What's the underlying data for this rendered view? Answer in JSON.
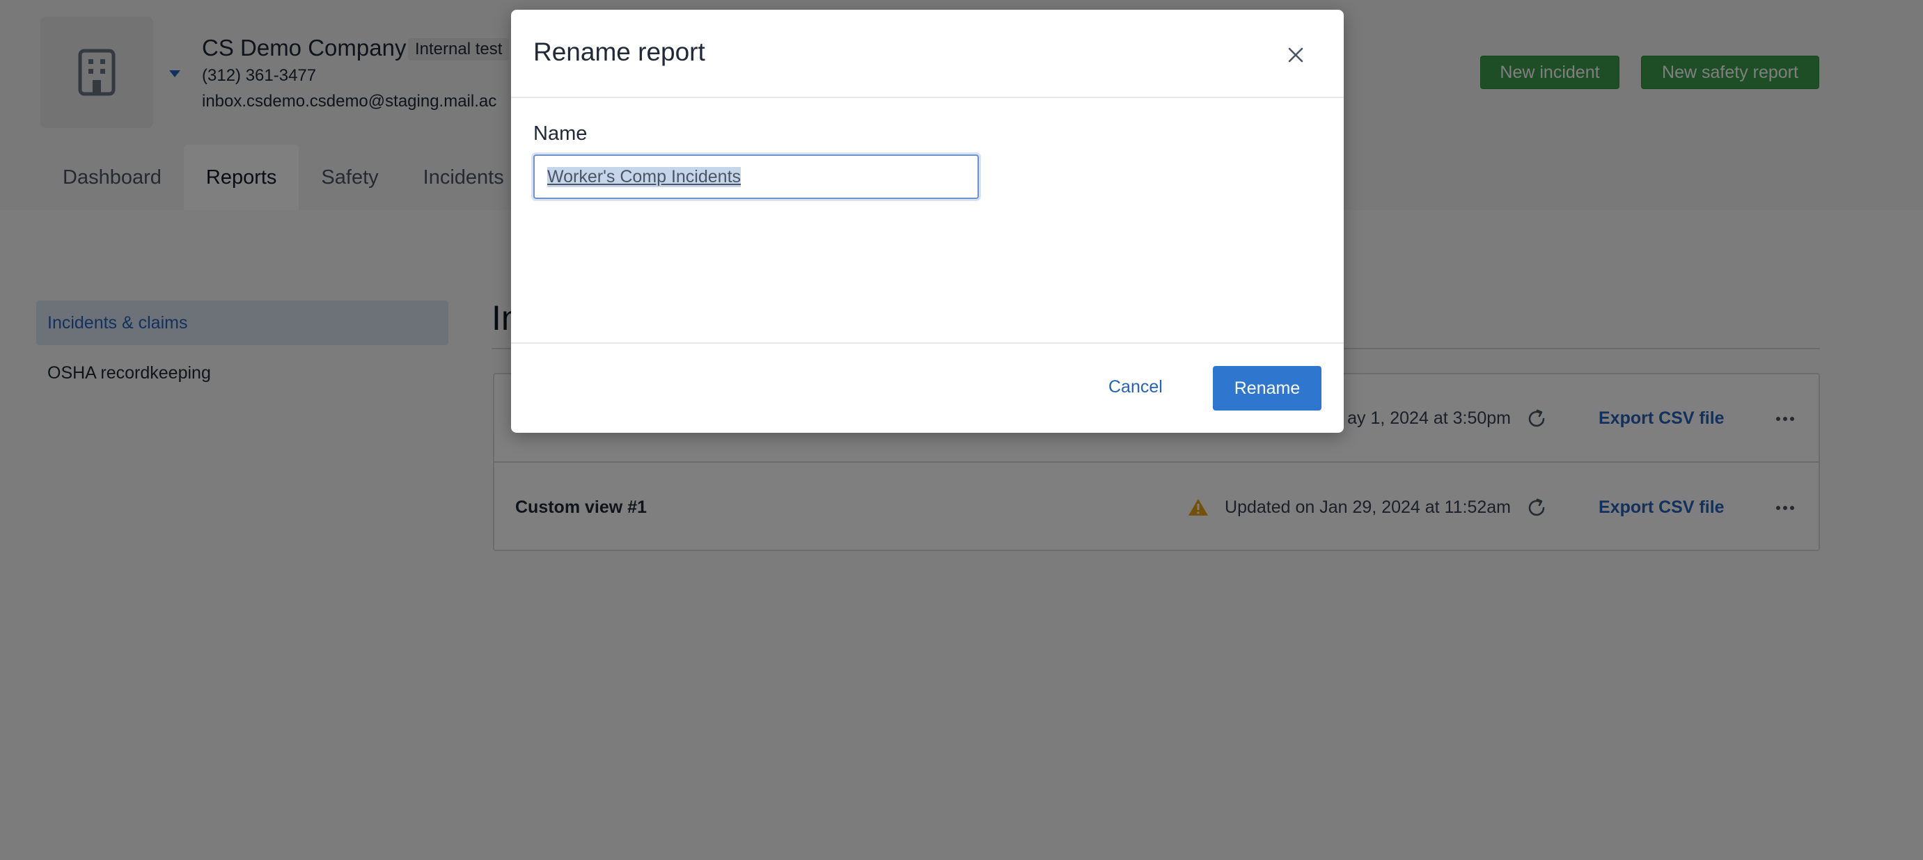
{
  "header": {
    "company_name": "CS Demo Company",
    "company_badge": "Internal test",
    "phone": "(312) 361-3477",
    "email": "inbox.csdemo.csdemo@staging.mail.ac",
    "new_incident_label": "New incident",
    "new_safety_report_label": "New safety report",
    "icons": {
      "logo": "building-icon",
      "dropdown": "caret-down-icon"
    }
  },
  "tabs": [
    {
      "label": "Dashboard",
      "active": false
    },
    {
      "label": "Reports",
      "active": true
    },
    {
      "label": "Safety",
      "active": false
    },
    {
      "label": "Incidents",
      "active": false
    }
  ],
  "sidebar": {
    "items": [
      {
        "label": "Incidents & claims",
        "active": true
      },
      {
        "label": "OSHA recordkeeping",
        "active": false
      }
    ]
  },
  "main": {
    "heading": "In",
    "reports": [
      {
        "name": "",
        "updated": "ay 1, 2024 at 3:50pm",
        "warning": false,
        "export_label": "Export CSV file"
      },
      {
        "name": "Custom view #1",
        "updated": "Updated on Jan 29, 2024 at 11:52am",
        "warning": true,
        "export_label": "Export CSV file"
      }
    ]
  },
  "modal": {
    "title": "Rename report",
    "field_label": "Name",
    "field_value": "Worker's Comp Incidents",
    "cancel_label": "Cancel",
    "rename_label": "Rename",
    "icons": {
      "close": "close-icon"
    }
  },
  "colors": {
    "accent_blue": "#2f76cf",
    "link_blue": "#2563b8",
    "green_button": "#3a9d4a",
    "warning": "#e8a317"
  }
}
